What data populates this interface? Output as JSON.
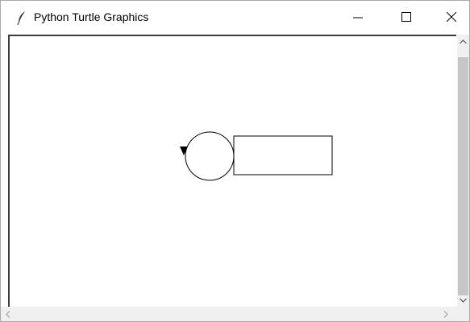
{
  "window": {
    "title": "Python Turtle Graphics",
    "icon": "feather-icon",
    "controls": [
      "minimize-icon",
      "maximize-icon",
      "close-icon"
    ]
  },
  "canvas": {
    "background": "#ffffff",
    "stroke_color": "#000000",
    "shapes": [
      {
        "kind": "circle",
        "description": "circle drawn by turtle"
      },
      {
        "kind": "rectangle",
        "description": "rectangle drawn by turtle"
      }
    ],
    "turtle": {
      "shape": "arrow",
      "heading": "south"
    }
  },
  "scrollbars": {
    "vertical": {
      "up_icon": "chevron-up-icon",
      "down_icon": "chevron-down-icon"
    },
    "horizontal": {
      "left_icon": "chevron-left-icon",
      "right_icon": "chevron-right-icon"
    }
  }
}
